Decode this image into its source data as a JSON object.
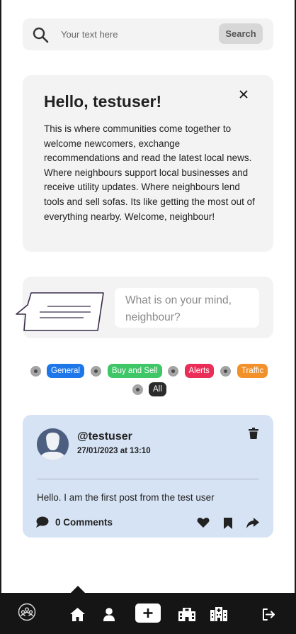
{
  "search": {
    "placeholder": "Your text here",
    "button_label": "Search",
    "icon": "search-icon"
  },
  "welcome": {
    "title": "Hello, testuser!",
    "body": "This is where communities come together to welcome newcomers, exchange recommendations and read the latest local news. Where neighbours support local businesses and receive utility updates. Where neighbours lend tools and sell sofas. Its like getting the most out of everything nearby. Welcome, neighbour!",
    "close_icon": "close-icon"
  },
  "composer": {
    "placeholder": "What is on your mind, neighbour?",
    "icon": "chat-bubble-icon"
  },
  "filters": [
    {
      "label": "General",
      "color": "#1e77e8"
    },
    {
      "label": "Buy and Sell",
      "color": "#3ec667"
    },
    {
      "label": "Alerts",
      "color": "#eb2e57"
    },
    {
      "label": "Traffic",
      "color": "#f2912a"
    },
    {
      "label": "All",
      "color": "#2c2c2c"
    }
  ],
  "post": {
    "username": "@testuser",
    "timestamp": "27/01/2023 at 13:10",
    "body": "Hello. I am the first post from the test user",
    "comments_label": "0 Comments",
    "background": "#d6e3f4"
  },
  "nav": {
    "items": [
      "community-icon",
      "home-icon",
      "profile-icon",
      "create-post-icon",
      "businesses-icon",
      "services-icon",
      "logout-icon"
    ],
    "active": "home-icon",
    "background": "#151515"
  }
}
